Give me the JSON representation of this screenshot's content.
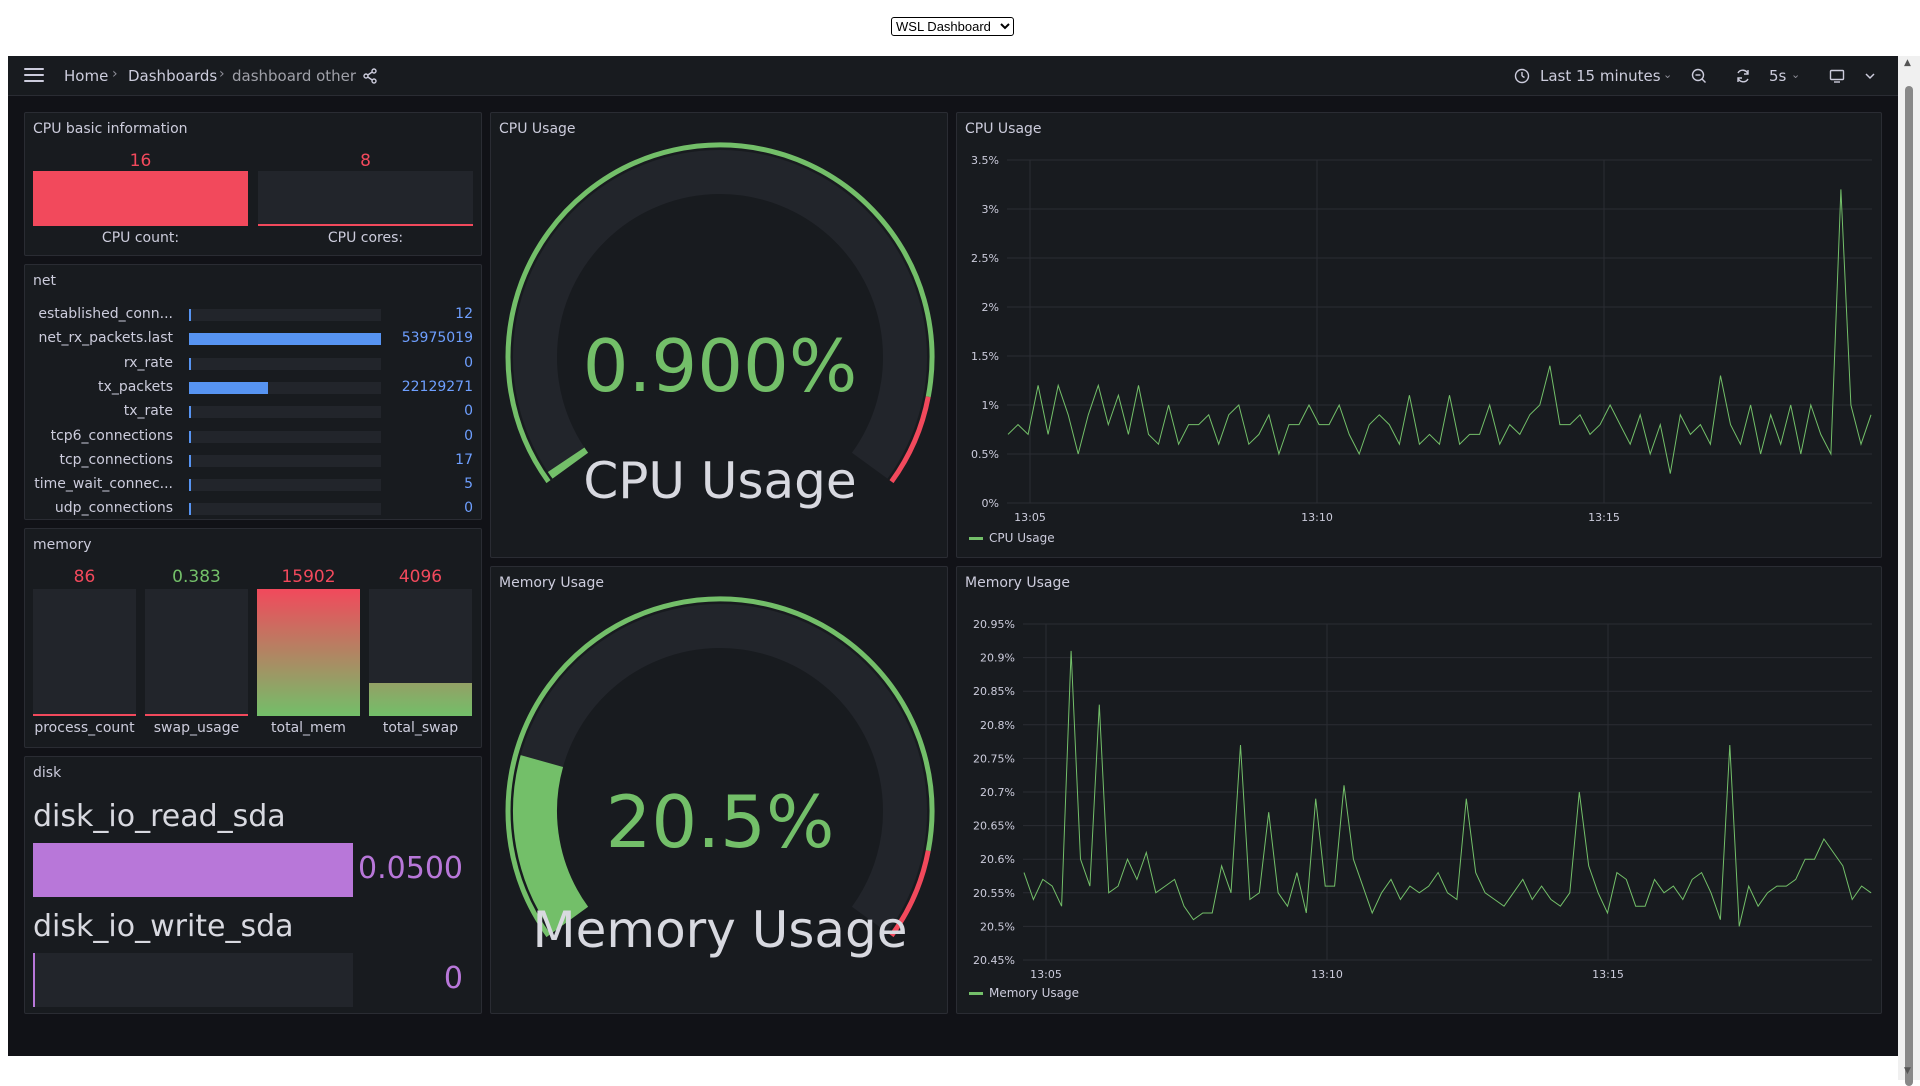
{
  "window": {
    "selector_value": "WSL Dashboard"
  },
  "navbar": {
    "breadcrumb": [
      "Home",
      "Dashboards",
      "dashboard other"
    ],
    "time_range": "Last 15 minutes",
    "refresh_interval": "5s"
  },
  "cpu_info": {
    "title": "CPU basic information",
    "stats": [
      {
        "label": "CPU count:",
        "value": "16",
        "color": "#f2495c"
      },
      {
        "label": "CPU cores:",
        "value": "8",
        "color": "#f2495c"
      }
    ]
  },
  "net": {
    "title": "net",
    "rows": [
      {
        "label": "established_conn...",
        "value": "12",
        "fraction": 0.0
      },
      {
        "label": "net_rx_packets.last",
        "value": "53975019",
        "fraction": 1.0
      },
      {
        "label": "rx_rate",
        "value": "0",
        "fraction": 0.0
      },
      {
        "label": "tx_packets",
        "value": "22129271",
        "fraction": 0.41
      },
      {
        "label": "tx_rate",
        "value": "0",
        "fraction": 0.0
      },
      {
        "label": "tcp6_connections",
        "value": "0",
        "fraction": 0.0
      },
      {
        "label": "tcp_connections",
        "value": "17",
        "fraction": 0.0
      },
      {
        "label": "time_wait_connec...",
        "value": "5",
        "fraction": 0.0
      },
      {
        "label": "udp_connections",
        "value": "0",
        "fraction": 0.0
      }
    ]
  },
  "memory": {
    "title": "memory",
    "stats": [
      {
        "label": "process_count",
        "value": "86",
        "color": "#f2495c",
        "fraction": 0.0
      },
      {
        "label": "swap_usage",
        "value": "0.383",
        "color": "#73bf69",
        "fraction": 0.0
      },
      {
        "label": "total_mem",
        "value": "15902",
        "color": "#f2495c",
        "fraction": 1.0
      },
      {
        "label": "total_swap",
        "value": "4096",
        "color": "#f2495c",
        "fraction": 0.26
      }
    ]
  },
  "disk": {
    "title": "disk",
    "rows": [
      {
        "label": "disk_io_read_sda",
        "value": "0.0500",
        "fraction": 1.0
      },
      {
        "label": "disk_io_write_sda",
        "value": "0",
        "fraction": 0.0
      }
    ]
  },
  "cpu_gauge": {
    "title": "CPU Usage",
    "value": "0.900%",
    "label": "CPU Usage",
    "fraction": 0.009,
    "color": "#73bf69"
  },
  "mem_gauge": {
    "title": "Memory Usage",
    "value": "20.5%",
    "label": "Memory Usage",
    "fraction": 0.205,
    "color": "#73bf69"
  },
  "chart_data": [
    {
      "type": "line",
      "title": "CPU Usage",
      "yticks": [
        "0%",
        "0.5%",
        "1%",
        "1.5%",
        "2%",
        "2.5%",
        "3%",
        "3.5%"
      ],
      "ylim": [
        0,
        3.5
      ],
      "xticks": [
        "13:05",
        "13:10",
        "13:15"
      ],
      "series": [
        {
          "name": "CPU Usage",
          "color": "#73bf69",
          "values": [
            0.7,
            0.8,
            0.7,
            1.2,
            0.7,
            1.2,
            0.9,
            0.5,
            0.9,
            1.2,
            0.8,
            1.1,
            0.7,
            1.2,
            0.7,
            0.6,
            1.0,
            0.6,
            0.8,
            0.8,
            0.9,
            0.6,
            0.9,
            1.0,
            0.6,
            0.7,
            0.9,
            0.5,
            0.8,
            0.8,
            1.0,
            0.8,
            0.8,
            1.0,
            0.7,
            0.5,
            0.8,
            0.9,
            0.8,
            0.6,
            1.1,
            0.6,
            0.7,
            0.6,
            1.1,
            0.6,
            0.7,
            0.7,
            1.0,
            0.6,
            0.8,
            0.7,
            0.9,
            1.0,
            1.4,
            0.8,
            0.8,
            0.9,
            0.7,
            0.8,
            1.0,
            0.8,
            0.6,
            0.9,
            0.5,
            0.8,
            0.3,
            0.9,
            0.7,
            0.8,
            0.6,
            1.3,
            0.8,
            0.6,
            1.0,
            0.5,
            0.9,
            0.6,
            1.0,
            0.5,
            1.0,
            0.7,
            0.5,
            3.2,
            1.0,
            0.6,
            0.9
          ]
        }
      ]
    },
    {
      "type": "line",
      "title": "Memory Usage",
      "yticks": [
        "20.45%",
        "20.5%",
        "20.55%",
        "20.6%",
        "20.65%",
        "20.7%",
        "20.75%",
        "20.8%",
        "20.85%",
        "20.9%",
        "20.95%"
      ],
      "ylim": [
        20.45,
        20.95
      ],
      "xticks": [
        "13:05",
        "13:10",
        "13:15"
      ],
      "series": [
        {
          "name": "Memory Usage",
          "color": "#73bf69",
          "values": [
            20.58,
            20.54,
            20.57,
            20.56,
            20.53,
            20.91,
            20.6,
            20.56,
            20.83,
            20.55,
            20.56,
            20.6,
            20.57,
            20.61,
            20.55,
            20.56,
            20.57,
            20.53,
            20.51,
            20.52,
            20.52,
            20.59,
            20.55,
            20.77,
            20.54,
            20.55,
            20.67,
            20.55,
            20.53,
            20.58,
            20.52,
            20.69,
            20.56,
            20.56,
            20.71,
            20.6,
            20.56,
            20.52,
            20.55,
            20.57,
            20.54,
            20.56,
            20.55,
            20.56,
            20.58,
            20.55,
            20.54,
            20.69,
            20.58,
            20.55,
            20.54,
            20.53,
            20.55,
            20.57,
            20.54,
            20.56,
            20.54,
            20.53,
            20.55,
            20.7,
            20.59,
            20.55,
            20.52,
            20.58,
            20.57,
            20.53,
            20.53,
            20.57,
            20.55,
            20.56,
            20.54,
            20.57,
            20.58,
            20.55,
            20.51,
            20.77,
            20.5,
            20.56,
            20.53,
            20.55,
            20.56,
            20.56,
            20.57,
            20.6,
            20.6,
            20.63,
            20.61,
            20.59,
            20.54,
            20.56,
            20.55
          ]
        }
      ]
    }
  ]
}
